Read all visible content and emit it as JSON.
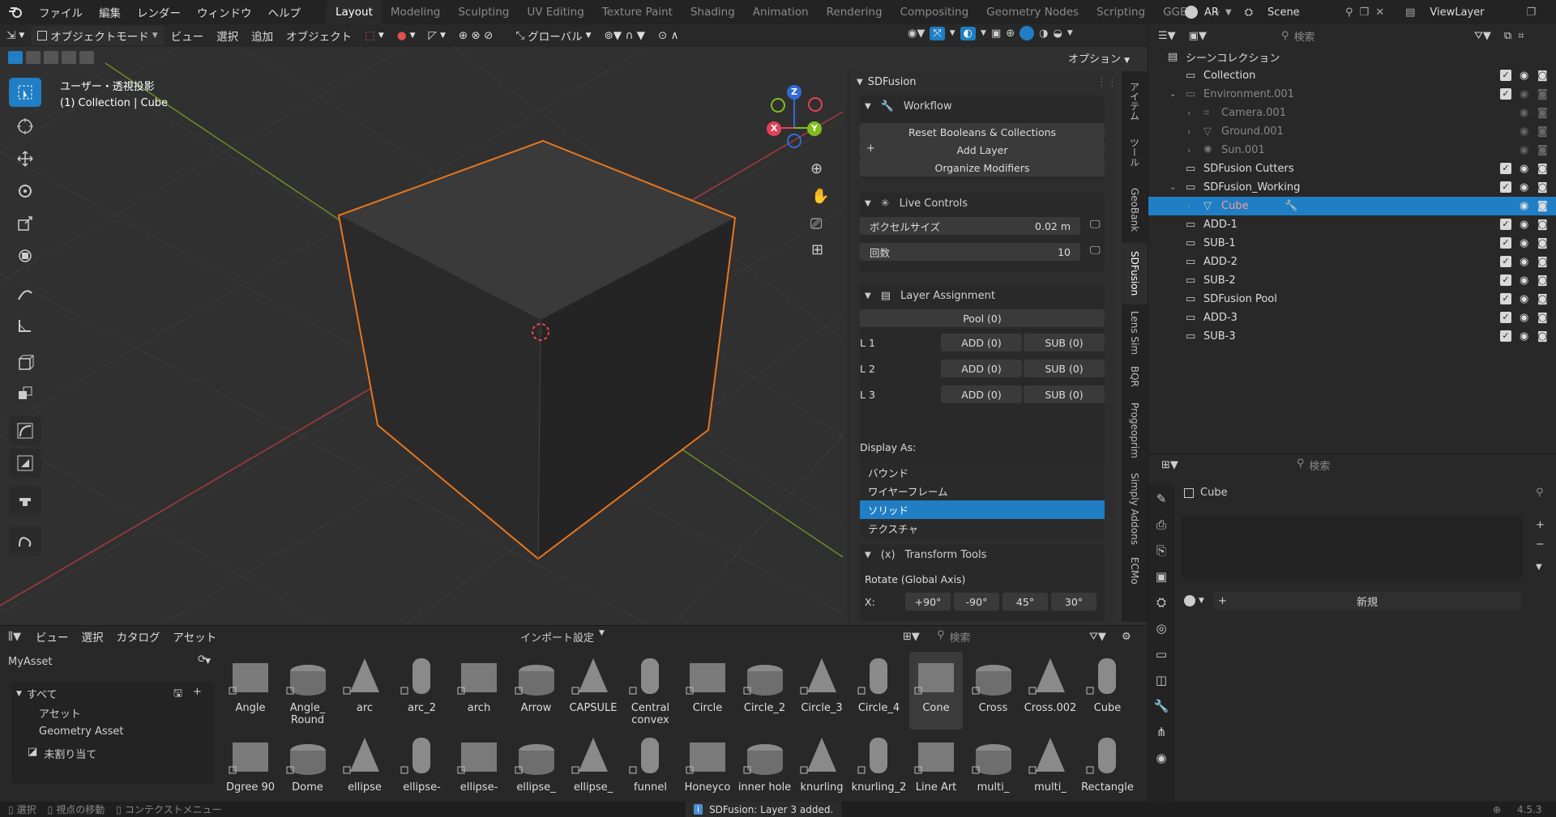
{
  "top_menu": [
    "ファイル",
    "編集",
    "レンダー",
    "ウィンドウ",
    "ヘルプ"
  ],
  "workspace_tabs": [
    "Layout",
    "Modeling",
    "Sculpting",
    "UV Editing",
    "Texture Paint",
    "Shading",
    "Animation",
    "Rendering",
    "Compositing",
    "Geometry Nodes",
    "Scripting",
    "GGEE"
  ],
  "top_right": {
    "language": "AR",
    "scene": "Scene",
    "view_layer": "ViewLayer"
  },
  "viewport_header": {
    "mode": "オブジェクトモード",
    "view": "ビュー",
    "select": "選択",
    "add": "追加",
    "object": "オブジェクト",
    "transform": "グローバル",
    "options": "オプション"
  },
  "viewport_info": {
    "title": "ユーザー・透視投影",
    "subtitle": "(1) Collection | Cube"
  },
  "gizmo_axes": {
    "z": "Z",
    "x": "X",
    "y": "Y"
  },
  "npanel": {
    "header": "SDFusion",
    "workflow": {
      "title": "Workflow",
      "buttons": [
        "Reset Booleans & Collections",
        "Add Layer",
        "Organize Modifiers"
      ]
    },
    "live_controls": {
      "title": "Live Controls",
      "voxel_label": "ボクセルサイズ",
      "voxel_value": "0.02 m",
      "iter_label": "回数",
      "iter_value": "10"
    },
    "layer_assignment": {
      "title": "Layer Assignment",
      "pool": "Pool (0)",
      "rows": [
        {
          "l": "L 1",
          "add": "ADD (0)",
          "sub": "SUB (0)"
        },
        {
          "l": "L 2",
          "add": "ADD (0)",
          "sub": "SUB (0)"
        },
        {
          "l": "L 3",
          "add": "ADD (0)",
          "sub": "SUB (0)"
        }
      ]
    },
    "display_as": {
      "label": "Display As:",
      "options": [
        "バウンド",
        "ワイヤーフレーム",
        "ソリッド",
        "テクスチャ"
      ],
      "selected": "ソリッド"
    },
    "transform_tools": {
      "title": "Transform Tools",
      "icon": "(x)",
      "rotate_label": "Rotate (Global Axis)",
      "axis": "X:",
      "angles": [
        "+90°",
        "-90°",
        "45°",
        "30°"
      ]
    }
  },
  "side_tabs": [
    "アイテム",
    "ツール",
    "GeoBank",
    "SDFusion",
    "Lens Sim",
    "BQR",
    "Progeoprim",
    "Simply Addons",
    "ECMo"
  ],
  "outliner": {
    "search_placeholder": "検索",
    "rows": [
      {
        "name": "シーンコレクション",
        "indent": 0,
        "type": "scene"
      },
      {
        "name": "Collection",
        "indent": 1,
        "type": "collection",
        "check": true
      },
      {
        "name": "Environment.001",
        "indent": 1,
        "type": "collection",
        "check": true,
        "dim": true,
        "expand": true
      },
      {
        "name": "Camera.001",
        "indent": 2,
        "type": "camera",
        "dim": true
      },
      {
        "name": "Ground.001",
        "indent": 2,
        "type": "mesh",
        "dim": true
      },
      {
        "name": "Sun.001",
        "indent": 2,
        "type": "light",
        "dim": true
      },
      {
        "name": "SDFusion Cutters",
        "indent": 1,
        "type": "collection",
        "check": true
      },
      {
        "name": "SDFusion_Working",
        "indent": 1,
        "type": "collection",
        "check": true,
        "expand": true
      },
      {
        "name": "Cube",
        "indent": 2,
        "type": "mesh",
        "selected": true
      },
      {
        "name": "ADD-1",
        "indent": 1,
        "type": "collection",
        "check": true
      },
      {
        "name": "SUB-1",
        "indent": 1,
        "type": "collection",
        "check": true
      },
      {
        "name": "ADD-2",
        "indent": 1,
        "type": "collection",
        "check": true
      },
      {
        "name": "SUB-2",
        "indent": 1,
        "type": "collection",
        "check": true
      },
      {
        "name": "SDFusion Pool",
        "indent": 1,
        "type": "collection",
        "check": true
      },
      {
        "name": "ADD-3",
        "indent": 1,
        "type": "collection",
        "check": true
      },
      {
        "name": "SUB-3",
        "indent": 1,
        "type": "collection",
        "check": true
      }
    ]
  },
  "properties": {
    "search_placeholder": "検索",
    "object": "Cube",
    "new_label": "新規"
  },
  "asset_browser": {
    "menu": [
      "ビュー",
      "選択",
      "カタログ",
      "アセット"
    ],
    "import": "インポート設定",
    "search_placeholder": "検索",
    "library": "MyAsset",
    "catalog": {
      "all": "すべて",
      "items": [
        "アセット",
        "Geometry Asset"
      ],
      "unassigned": "未割り当て"
    },
    "row1": [
      "Angle",
      "Angle_\nRound",
      "arc",
      "arc_2",
      "arch",
      "Arrow",
      "CAPSULE",
      "Central\nconvex",
      "Circle",
      "Circle_2",
      "Circle_3",
      "Circle_4",
      "Cone",
      "Cross",
      "Cross.002",
      "Cube"
    ],
    "row2": [
      "Dgree 90",
      "Dome",
      "ellipse",
      "ellipse-",
      "ellipse-",
      "ellipse_",
      "ellipse_",
      "funnel",
      "Honeyco",
      "inner hole",
      "knurling",
      "knurling_2",
      "Line Art",
      "multi_",
      "multi_",
      "Rectangle"
    ],
    "selected": "Cone"
  },
  "status": {
    "select": "選択",
    "move_view": "視点の移動",
    "context_menu": "コンテクストメニュー",
    "message": "SDFusion: Layer 3 added.",
    "version": "4.5.3"
  },
  "colors": {
    "accent": "#4b8ed6",
    "selected_blue": "#1f7ec4",
    "orange": "#e8761c",
    "viewport_bg": "#303030"
  }
}
